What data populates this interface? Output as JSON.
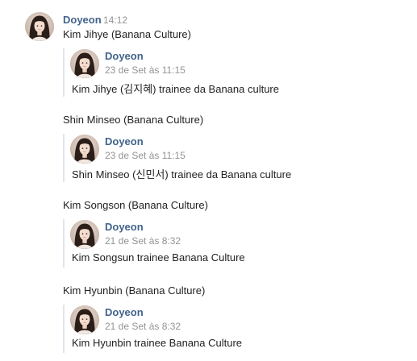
{
  "message": {
    "author": "Doyeon",
    "time": "14:12",
    "lines": [
      "Kim Jihye (Banana Culture)",
      "Shin Minseo (Banana Culture)",
      "Kim Songson (Banana Culture)",
      "Kim Hyunbin (Banana Culture)"
    ]
  },
  "forwarded": [
    {
      "author": "Doyeon",
      "date": "23 de Set às 11:15",
      "text": "Kim Jihye (김지혜) trainee da Banana culture"
    },
    {
      "author": "Doyeon",
      "date": "23 de Set às 11:15",
      "text": "Shin Minseo (신민서) trainee da Banana culture"
    },
    {
      "author": "Doyeon",
      "date": "21 de Set às 8:32",
      "text": "Kim Songsun trainee Banana Culture"
    },
    {
      "author": "Doyeon",
      "date": "21 de Set às 8:32",
      "text": "Kim Hyunbin trainee Banana Culture"
    }
  ],
  "colors": {
    "author": "#42648b",
    "timestamp": "#939393",
    "quote_bar": "#dfe6ed",
    "text": "#222222"
  },
  "icons": {
    "avatar": "profile-photo-avatar"
  }
}
